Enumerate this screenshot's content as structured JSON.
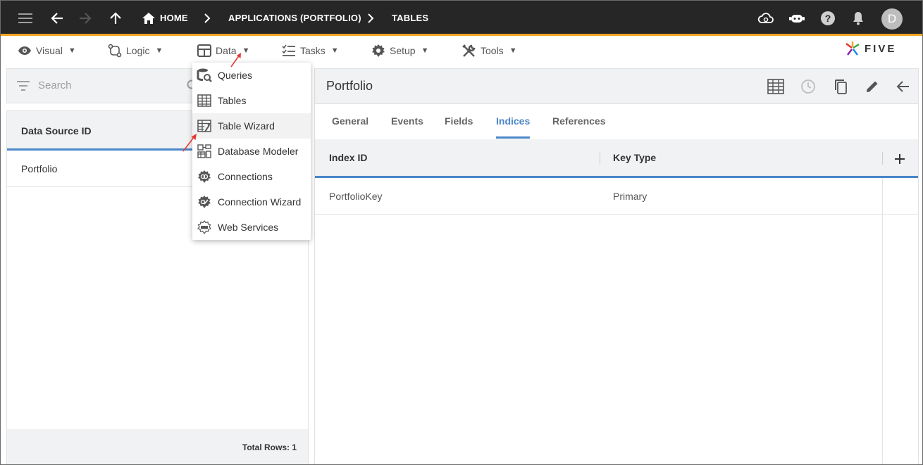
{
  "breadcrumb": {
    "home": "HOME",
    "applications": "APPLICATIONS (PORTFOLIO)",
    "tables": "TABLES"
  },
  "user": {
    "avatar_initial": "D"
  },
  "menubar": {
    "visual": "Visual",
    "logic": "Logic",
    "data": "Data",
    "tasks": "Tasks",
    "setup": "Setup",
    "tools": "Tools",
    "caret": "▼"
  },
  "logo": {
    "text": "FIVE"
  },
  "data_menu": {
    "items": [
      {
        "label": "Queries",
        "icon": "queries-icon"
      },
      {
        "label": "Tables",
        "icon": "tables-icon"
      },
      {
        "label": "Table Wizard",
        "icon": "table-wizard-icon"
      },
      {
        "label": "Database Modeler",
        "icon": "database-modeler-icon"
      },
      {
        "label": "Connections",
        "icon": "connections-icon"
      },
      {
        "label": "Connection Wizard",
        "icon": "connection-wizard-icon"
      },
      {
        "label": "Web Services",
        "icon": "web-services-icon"
      }
    ],
    "hovered_index": 2
  },
  "left_panel": {
    "search_placeholder": "Search",
    "column_header": "Data Source ID",
    "rows": [
      "Portfolio"
    ],
    "footer": "Total Rows: 1"
  },
  "right_panel": {
    "title": "Portfolio",
    "tabs": [
      "General",
      "Events",
      "Fields",
      "Indices",
      "References"
    ],
    "active_tab": "Indices",
    "columns": [
      "Index ID",
      "Key Type"
    ],
    "rows": [
      {
        "index_id": "PortfolioKey",
        "key_type": "Primary"
      }
    ]
  },
  "colors": {
    "topbar": "#262626",
    "accent_orange": "#f5a623",
    "accent_blue": "#4a86c8",
    "annotation_red": "#e53935"
  }
}
